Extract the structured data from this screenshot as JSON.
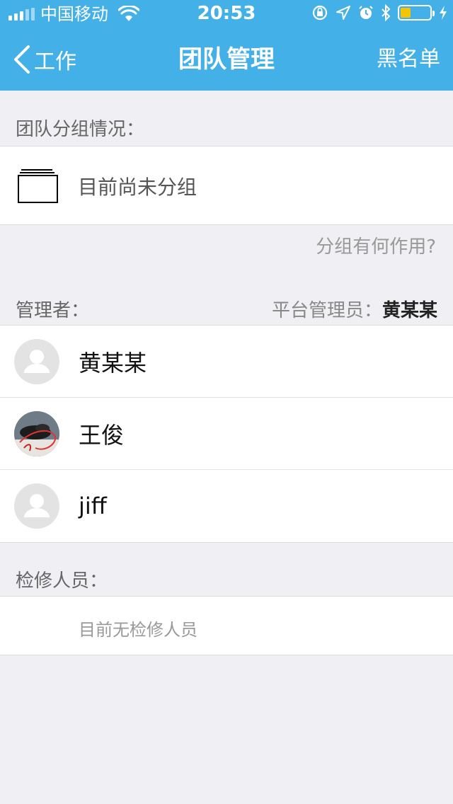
{
  "status_bar": {
    "carrier": "中国移动",
    "time": "20:53",
    "battery_level": 0.35,
    "battery_color": "#f5c400"
  },
  "nav": {
    "back_label": "工作",
    "title": "团队管理",
    "right_label": "黑名单",
    "background": "#44b0e8"
  },
  "groups": {
    "section_label": "团队分组情况：",
    "empty_text": "目前尚未分组",
    "help_link": "分组有何作用?"
  },
  "managers": {
    "section_label": "管理者：",
    "platform_admin_label": "平台管理员：",
    "platform_admin_name": "黄某某",
    "members": [
      {
        "name": "黄某某",
        "avatar": "default-avatar"
      },
      {
        "name": "王俊",
        "avatar": "photo-avatar"
      },
      {
        "name": "jiff",
        "avatar": "default-avatar"
      }
    ]
  },
  "maintenance": {
    "section_label": "检修人员：",
    "empty_text": "目前无检修人员"
  }
}
